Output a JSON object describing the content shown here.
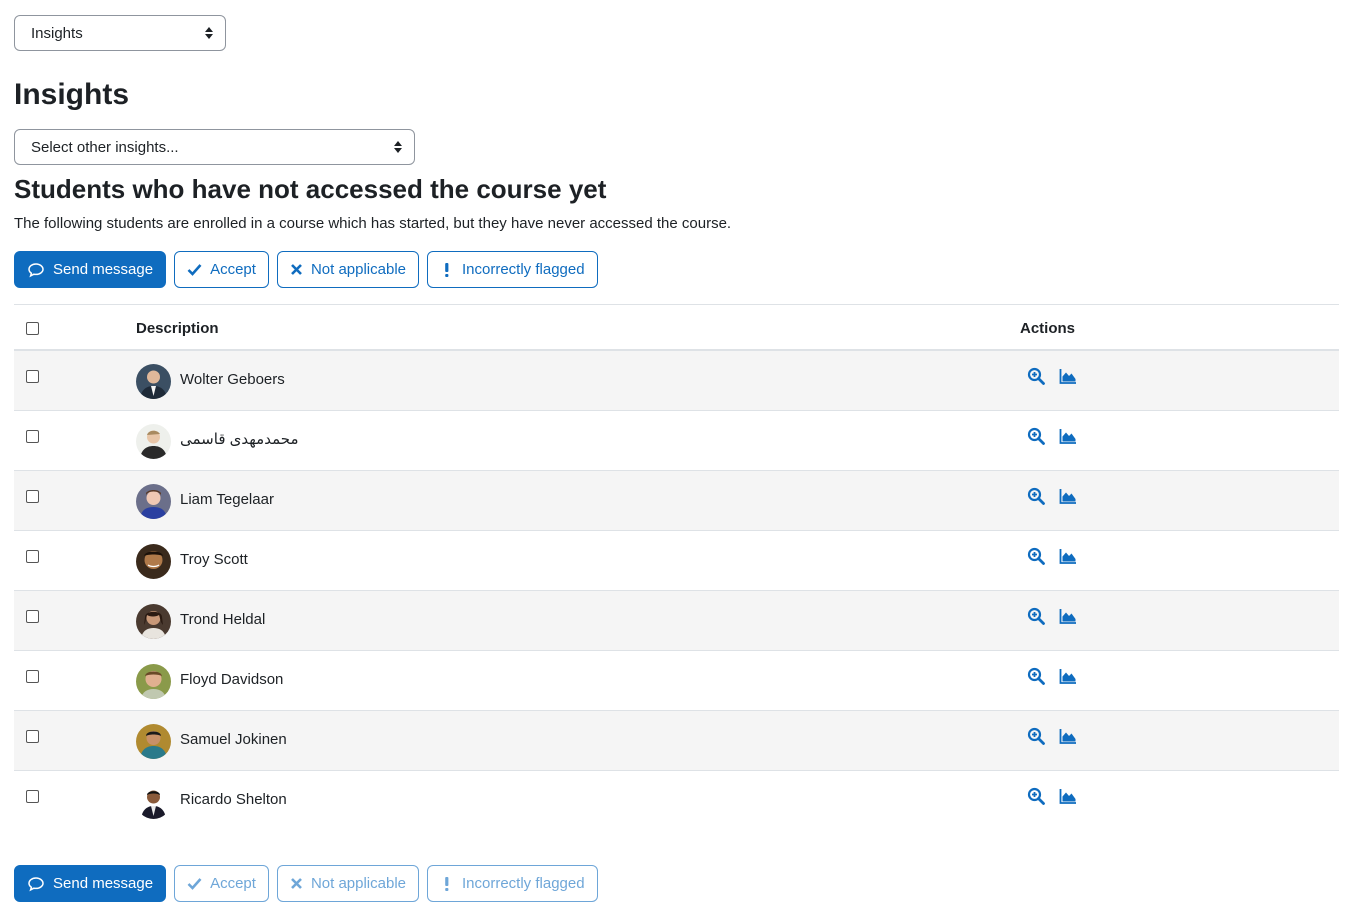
{
  "top_select": {
    "value": "Insights"
  },
  "page_title": "Insights",
  "other_select": {
    "placeholder": "Select other insights..."
  },
  "insight": {
    "title": "Students who have not accessed the course yet",
    "description": "The following students are enrolled in a course which has started, but they have never accessed the course."
  },
  "actions": {
    "send_message": "Send message",
    "accept": "Accept",
    "not_applicable": "Not applicable",
    "incorrectly_flagged": "Incorrectly flagged"
  },
  "table": {
    "headers": {
      "description": "Description",
      "actions": "Actions"
    },
    "rows": [
      {
        "name": "Wolter Geboers"
      },
      {
        "name": "محمدمهدی قاسمی"
      },
      {
        "name": "Liam Tegelaar"
      },
      {
        "name": "Troy Scott"
      },
      {
        "name": "Trond Heldal"
      },
      {
        "name": "Floyd Davidson"
      },
      {
        "name": "Samuel Jokinen"
      },
      {
        "name": "Ricardo Shelton"
      }
    ]
  },
  "icons": {
    "view": "zoom-in-icon",
    "chart": "area-chart-icon",
    "message": "chat-bubble-icon",
    "accept": "check-icon",
    "not_applicable": "x-icon",
    "incorrect": "exclamation-icon"
  },
  "colors": {
    "primary": "#0f6cbf",
    "row_stripe": "#f5f5f5",
    "border": "#dee2e6"
  }
}
